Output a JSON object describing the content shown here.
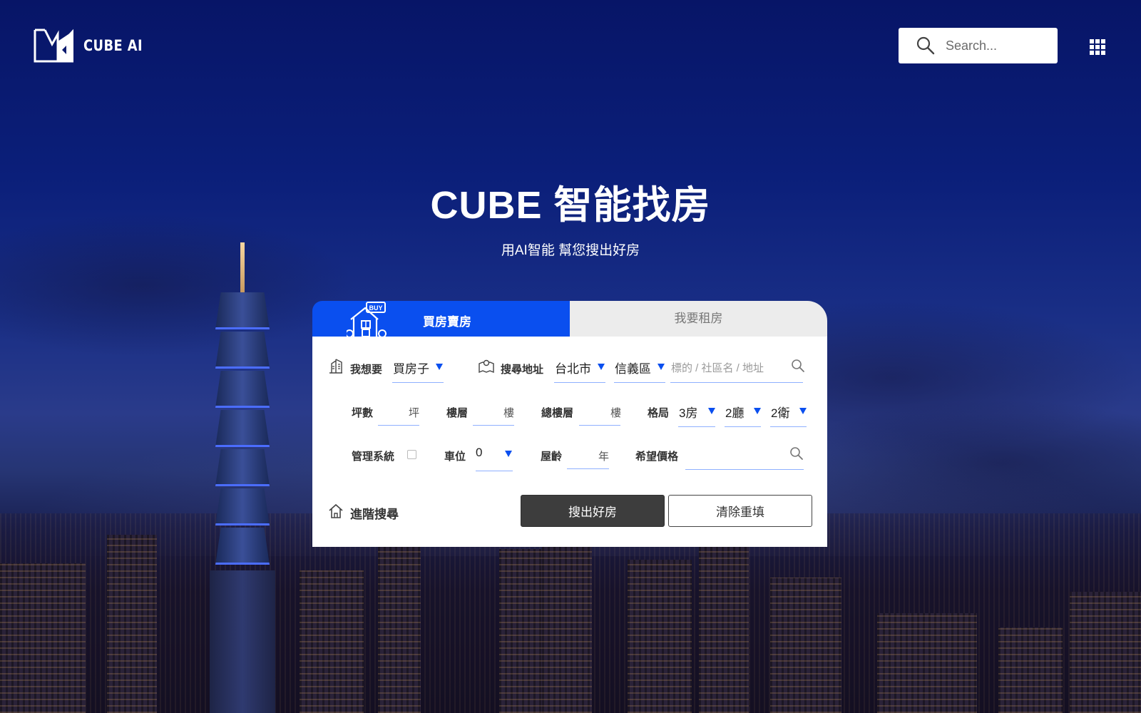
{
  "brand": {
    "name": "CUBE AI"
  },
  "header": {
    "search_placeholder": "Search...",
    "apps_icon": "grid-icon"
  },
  "hero": {
    "title": "CUBE 智能找房",
    "subtitle": "用AI智能 幫您搜出好房"
  },
  "tabs": [
    {
      "label": "買房賣房",
      "active": true,
      "icon": "buy-house-icon",
      "badge": "BUY"
    },
    {
      "label": "我要租房",
      "active": false
    }
  ],
  "form": {
    "want": {
      "label": "我想要",
      "value": "買房子",
      "icon": "building-icon"
    },
    "address": {
      "label": "搜尋地址",
      "icon": "map-icon",
      "city": "台北市",
      "district": "信義區",
      "placeholder": "標的 / 社區名 / 地址"
    },
    "area": {
      "label": "坪數",
      "unit": "坪"
    },
    "floor": {
      "label": "樓層",
      "unit": "樓"
    },
    "total_floors": {
      "label": "總樓層",
      "unit": "樓"
    },
    "layout": {
      "label": "格局",
      "rooms": "3房",
      "halls": "2廳",
      "baths": "2衛"
    },
    "management": {
      "label": "管理系統",
      "checked": false
    },
    "parking": {
      "label": "車位",
      "value": "0"
    },
    "age": {
      "label": "屋齡",
      "unit": "年"
    },
    "price": {
      "label": "希望價格"
    },
    "advanced": {
      "label": "進階搜尋",
      "icon": "home-outline-icon"
    },
    "submit_label": "搜出好房",
    "clear_label": "清除重填"
  },
  "colors": {
    "accent": "#0a4fef",
    "underline": "#8fb0ff",
    "button_dark": "#3d3d3d"
  }
}
